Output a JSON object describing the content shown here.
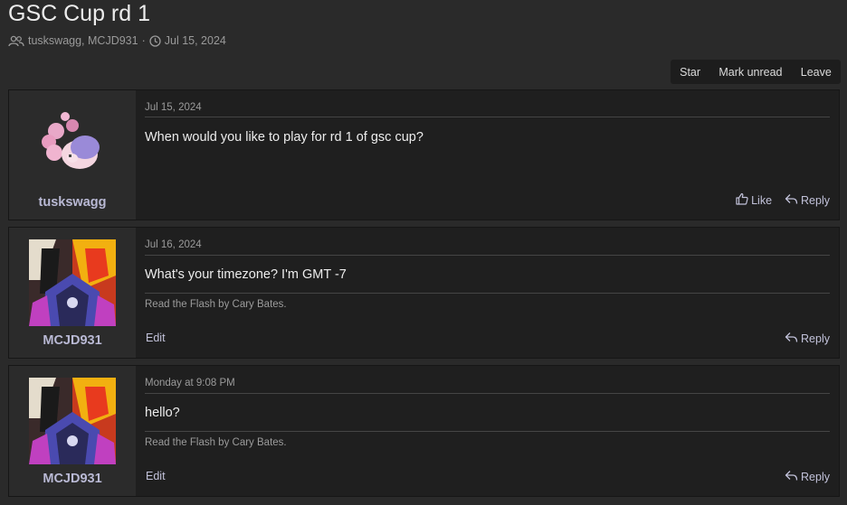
{
  "thread": {
    "title": "GSC Cup rd 1",
    "participants": "tuskswagg, MCJD931",
    "separator": "·",
    "date": "Jul 15, 2024"
  },
  "actions": {
    "star": "Star",
    "mark_unread": "Mark unread",
    "leave": "Leave"
  },
  "messages": [
    {
      "username": "tuskswagg",
      "date": "Jul 15, 2024",
      "body": "When would you like to play for rd 1 of gsc cup?",
      "signature": "",
      "edit_label": "",
      "like_label": "Like",
      "reply_label": "Reply"
    },
    {
      "username": "MCJD931",
      "date": "Jul 16, 2024",
      "body": "What's your timezone? I'm GMT -7",
      "signature": "Read the Flash by Cary Bates.",
      "edit_label": "Edit",
      "reply_label": "Reply"
    },
    {
      "username": "MCJD931",
      "date": "Monday at 9:08 PM",
      "body": "hello?",
      "signature": "Read the Flash by Cary Bates.",
      "edit_label": "Edit",
      "reply_label": "Reply"
    }
  ],
  "icons": {
    "participants": "users-icon",
    "date": "clock-icon",
    "like": "thumbs-up-icon",
    "reply": "reply-arrow-icon"
  }
}
